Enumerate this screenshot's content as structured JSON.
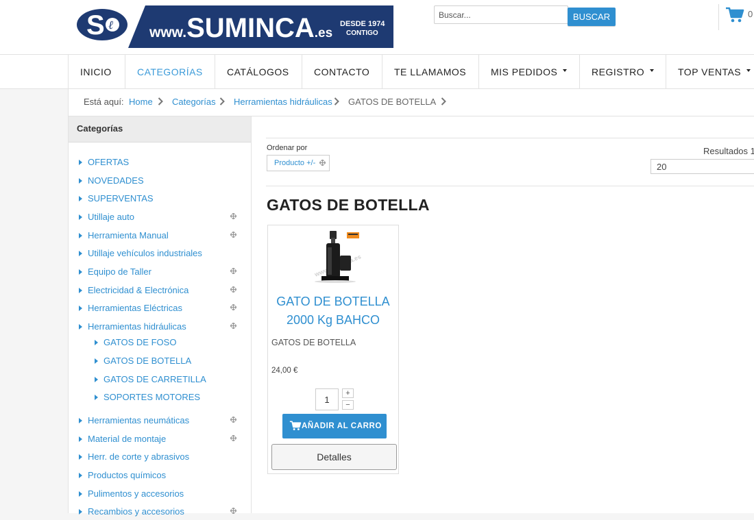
{
  "header": {
    "logo_text": "www.SUMINCA.es",
    "logo_tagline_1": "DESDE 1974",
    "logo_tagline_2": "CONTIGO",
    "search_placeholder": "Buscar...",
    "search_button": "BUSCAR",
    "cart_text": "0"
  },
  "colors": {
    "accent": "#2f8fd0",
    "logo_navy": "#1e3a72",
    "text_dark": "#222222"
  },
  "nav": {
    "items": [
      {
        "label": "INICIO",
        "active": false,
        "dropdown": false
      },
      {
        "label": "CATEGORÍAS",
        "active": true,
        "dropdown": false
      },
      {
        "label": "CATÁLOGOS",
        "active": false,
        "dropdown": false
      },
      {
        "label": "CONTACTO",
        "active": false,
        "dropdown": false
      },
      {
        "label": "TE LLAMAMOS",
        "active": false,
        "dropdown": false
      },
      {
        "label": "MIS PEDIDOS",
        "active": false,
        "dropdown": true
      },
      {
        "label": "REGISTRO",
        "active": false,
        "dropdown": true
      },
      {
        "label": "TOP VENTAS",
        "active": false,
        "dropdown": true
      }
    ]
  },
  "breadcrumb": {
    "prefix": "Está aquí:",
    "items": [
      "Home",
      "Categorías",
      "Herramientas hidráulicas",
      "GATOS DE BOTELLA"
    ]
  },
  "sidebar": {
    "title": "Categorías",
    "items": [
      {
        "label": "OFERTAS",
        "level": 0,
        "expandable": false
      },
      {
        "label": "NOVEDADES",
        "level": 0,
        "expandable": false
      },
      {
        "label": "SUPERVENTAS",
        "level": 0,
        "expandable": false
      },
      {
        "label": "Utillaje auto",
        "level": 0,
        "expandable": true
      },
      {
        "label": "Herramienta Manual",
        "level": 0,
        "expandable": true
      },
      {
        "label": "Utillaje vehículos industriales",
        "level": 0,
        "expandable": false
      },
      {
        "label": "Equipo de Taller",
        "level": 0,
        "expandable": true
      },
      {
        "label": "Electricidad & Electrónica",
        "level": 0,
        "expandable": true
      },
      {
        "label": "Herramientas Eléctricas",
        "level": 0,
        "expandable": true
      },
      {
        "label": "Herramientas hidráulicas",
        "level": 0,
        "expandable": true
      },
      {
        "label": "GATOS DE FOSO",
        "level": 1,
        "expandable": false
      },
      {
        "label": "GATOS DE BOTELLA",
        "level": 1,
        "expandable": false
      },
      {
        "label": "GATOS DE CARRETILLA",
        "level": 1,
        "expandable": false
      },
      {
        "label": "SOPORTES MOTORES",
        "level": 1,
        "expandable": false
      },
      {
        "label": "Herramientas neumáticas",
        "level": 0,
        "expandable": true
      },
      {
        "label": "Material de montaje",
        "level": 0,
        "expandable": true
      },
      {
        "label": "Herr. de corte y abrasivos",
        "level": 0,
        "expandable": false
      },
      {
        "label": "Productos químicos",
        "level": 0,
        "expandable": false
      },
      {
        "label": "Pulimentos y accesorios",
        "level": 0,
        "expandable": false
      },
      {
        "label": "Recambios y accesorios",
        "level": 0,
        "expandable": true
      }
    ]
  },
  "listing": {
    "sort_label": "Ordenar por",
    "sort_button": "Producto +/-",
    "results_label": "Resultados 1",
    "limit_value": "20",
    "title": "GATOS DE BOTELLA"
  },
  "product": {
    "name": "GATO DE BOTELLA 2000 Kg BAHCO",
    "category": "GATOS DE BOTELLA",
    "price": "24,00 €",
    "quantity": "1",
    "qty_plus": "+",
    "qty_minus": "−",
    "add_to_cart": "AÑADIR AL CARRO",
    "details": "Detalles"
  }
}
